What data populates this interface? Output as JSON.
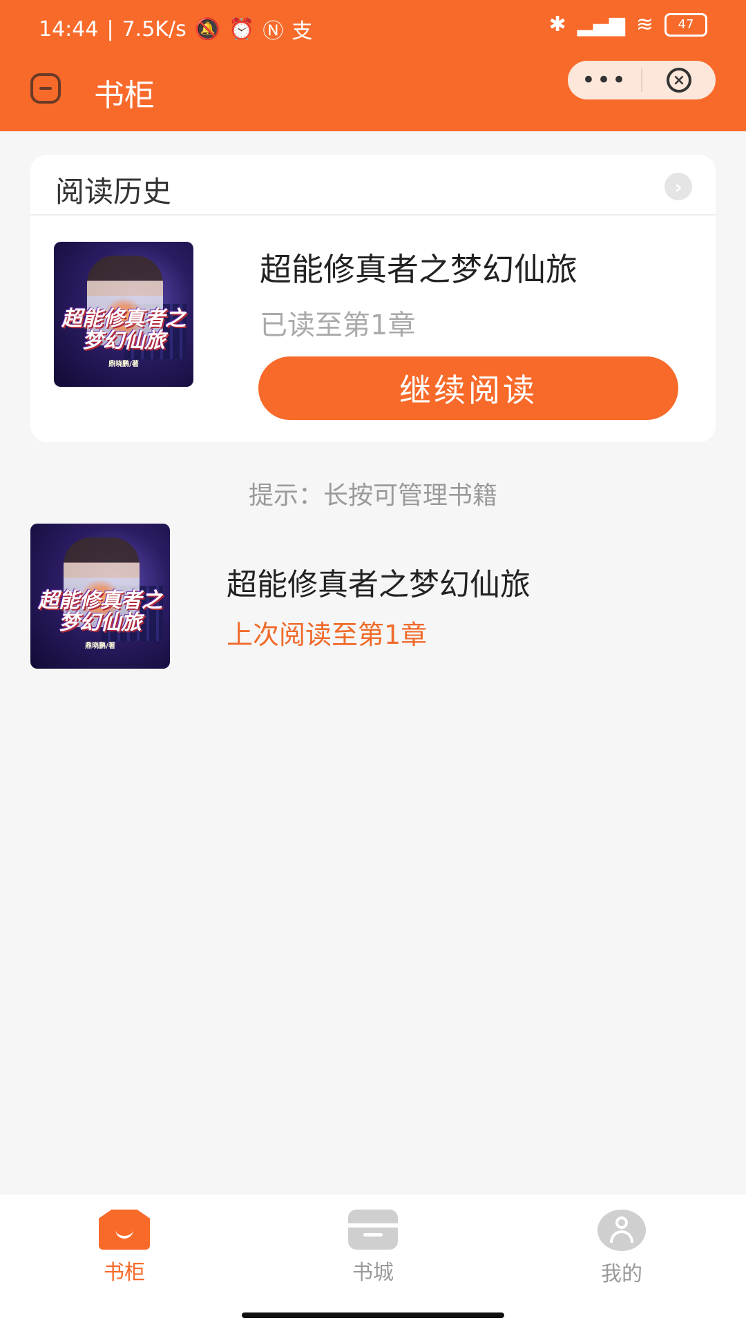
{
  "status_bar": {
    "time": "14:44",
    "speed": "7.5K/s",
    "battery": "47",
    "icons": [
      "mute-bell-icon",
      "alarm-icon",
      "nfc-icon",
      "alipay-icon",
      "bluetooth-icon",
      "signal-icon",
      "wifi-icon",
      "battery-icon"
    ]
  },
  "nav": {
    "title": "书柜",
    "more_label": "•••",
    "close_label": "×"
  },
  "history": {
    "title": "阅读历史",
    "arrow": "›",
    "book": {
      "title": "超能修真者之梦幻仙旅",
      "progress": "已读至第1章",
      "cover_text": "超能修真者之梦幻仙旅",
      "cover_author": "鼎晓鹏/著"
    },
    "continue_label": "继续阅读"
  },
  "tip": "提示：长按可管理书籍",
  "shelf": {
    "books": [
      {
        "title": "超能修真者之梦幻仙旅",
        "progress": "上次阅读至第1章",
        "cover_text": "超能修真者之梦幻仙旅",
        "cover_author": "鼎晓鹏/著"
      }
    ]
  },
  "tabbar": {
    "tabs": [
      {
        "label": "书柜",
        "icon": "shelf-icon",
        "active": true
      },
      {
        "label": "书城",
        "icon": "store-icon",
        "active": false
      },
      {
        "label": "我的",
        "icon": "me-icon",
        "active": false
      }
    ]
  },
  "colors": {
    "accent": "#f86a2a",
    "progress_highlight": "#f06a2a",
    "inactive_tab": "#9a9a9a"
  }
}
